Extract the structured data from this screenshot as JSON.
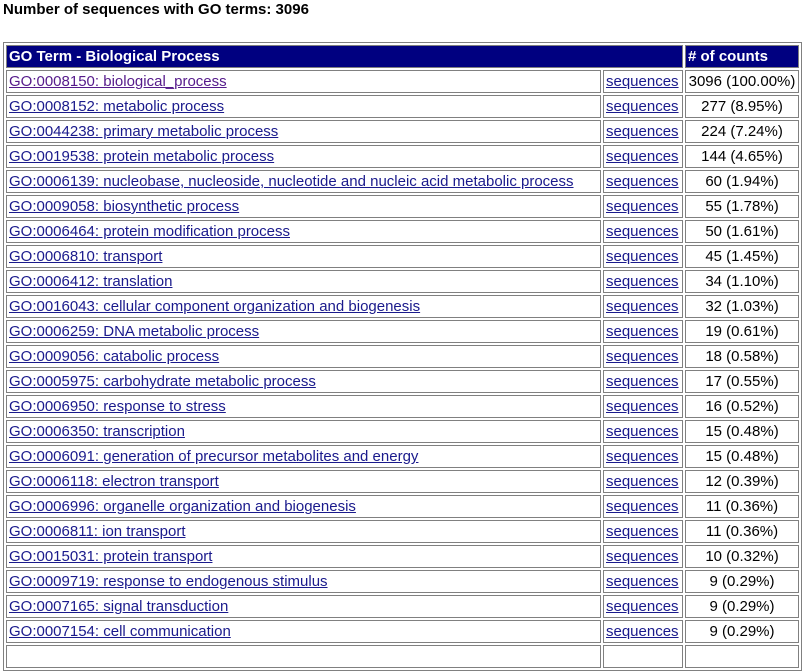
{
  "header": {
    "title": "Number of sequences with GO terms: 3096"
  },
  "table": {
    "col_term": "GO Term - Biological Process",
    "col_count": "# of counts",
    "link_label": "sequences",
    "rows": [
      {
        "term": "GO:0008150: biological_process",
        "count": "3096 (100.00%)",
        "visited": true
      },
      {
        "term": "GO:0008152: metabolic process",
        "count": "277 (8.95%)"
      },
      {
        "term": "GO:0044238: primary metabolic process",
        "count": "224 (7.24%)"
      },
      {
        "term": "GO:0019538: protein metabolic process",
        "count": "144 (4.65%)"
      },
      {
        "term": "GO:0006139: nucleobase, nucleoside, nucleotide and nucleic acid metabolic process",
        "count": "60 (1.94%)"
      },
      {
        "term": "GO:0009058: biosynthetic process",
        "count": "55 (1.78%)"
      },
      {
        "term": "GO:0006464: protein modification process",
        "count": "50 (1.61%)"
      },
      {
        "term": "GO:0006810: transport",
        "count": "45 (1.45%)"
      },
      {
        "term": "GO:0006412: translation",
        "count": "34 (1.10%)"
      },
      {
        "term": "GO:0016043: cellular component organization and biogenesis",
        "count": "32 (1.03%)"
      },
      {
        "term": "GO:0006259: DNA metabolic process",
        "count": "19 (0.61%)"
      },
      {
        "term": "GO:0009056: catabolic process",
        "count": "18 (0.58%)"
      },
      {
        "term": "GO:0005975: carbohydrate metabolic process",
        "count": "17 (0.55%)"
      },
      {
        "term": "GO:0006950: response to stress",
        "count": "16 (0.52%)"
      },
      {
        "term": "GO:0006350: transcription",
        "count": "15 (0.48%)"
      },
      {
        "term": "GO:0006091: generation of precursor metabolites and energy",
        "count": "15 (0.48%)"
      },
      {
        "term": "GO:0006118: electron transport",
        "count": "12 (0.39%)"
      },
      {
        "term": "GO:0006996: organelle organization and biogenesis",
        "count": "11 (0.36%)"
      },
      {
        "term": "GO:0006811: ion transport",
        "count": "11 (0.36%)"
      },
      {
        "term": "GO:0015031: protein transport",
        "count": "10 (0.32%)"
      },
      {
        "term": "GO:0009719: response to endogenous stimulus",
        "count": "9 (0.29%)"
      },
      {
        "term": "GO:0007165: signal transduction",
        "count": "9 (0.29%)"
      },
      {
        "term": "GO:0007154: cell communication",
        "count": "9 (0.29%)"
      },
      {
        "term": "",
        "count": ""
      }
    ]
  }
}
